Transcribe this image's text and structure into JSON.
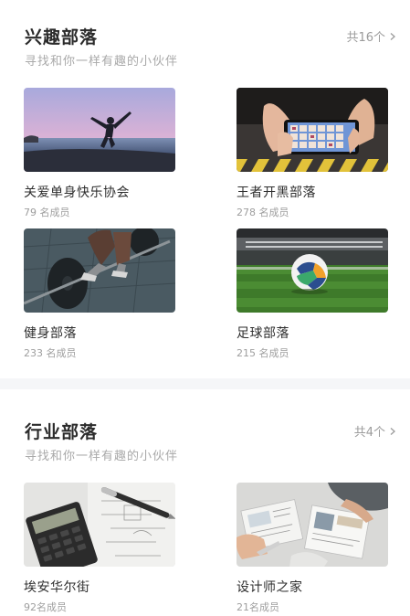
{
  "interest": {
    "title": "兴趣部落",
    "subtitle": "寻找和你一样有趣的小伙伴",
    "count": "共16个",
    "tribes": [
      {
        "name": "关爱单身快乐协会",
        "members": "79 名成员",
        "image": "beach-jump-photo"
      },
      {
        "name": "王者开黑部落",
        "members": "278 名成员",
        "image": "phone-game-photo"
      },
      {
        "name": "健身部落",
        "members": "233 名成员",
        "image": "gym-deadlift-photo"
      },
      {
        "name": "足球部落",
        "members": "215 名成员",
        "image": "soccer-ball-photo"
      }
    ]
  },
  "industry": {
    "title": "行业部落",
    "subtitle": "寻找和你一样有趣的小伙伴",
    "count": "共4个",
    "tribes": [
      {
        "name": "埃安华尔街",
        "members": "92名成员",
        "image": "calculator-pen-photo"
      },
      {
        "name": "设计师之家",
        "members": "21名成员",
        "image": "design-desk-photo"
      }
    ]
  },
  "colors": {
    "background": "#ffffff",
    "divider": "#f5f6f8",
    "title": "#2b2b2b",
    "subtitle": "#a9a9a9",
    "meta": "#9e9e9e"
  }
}
